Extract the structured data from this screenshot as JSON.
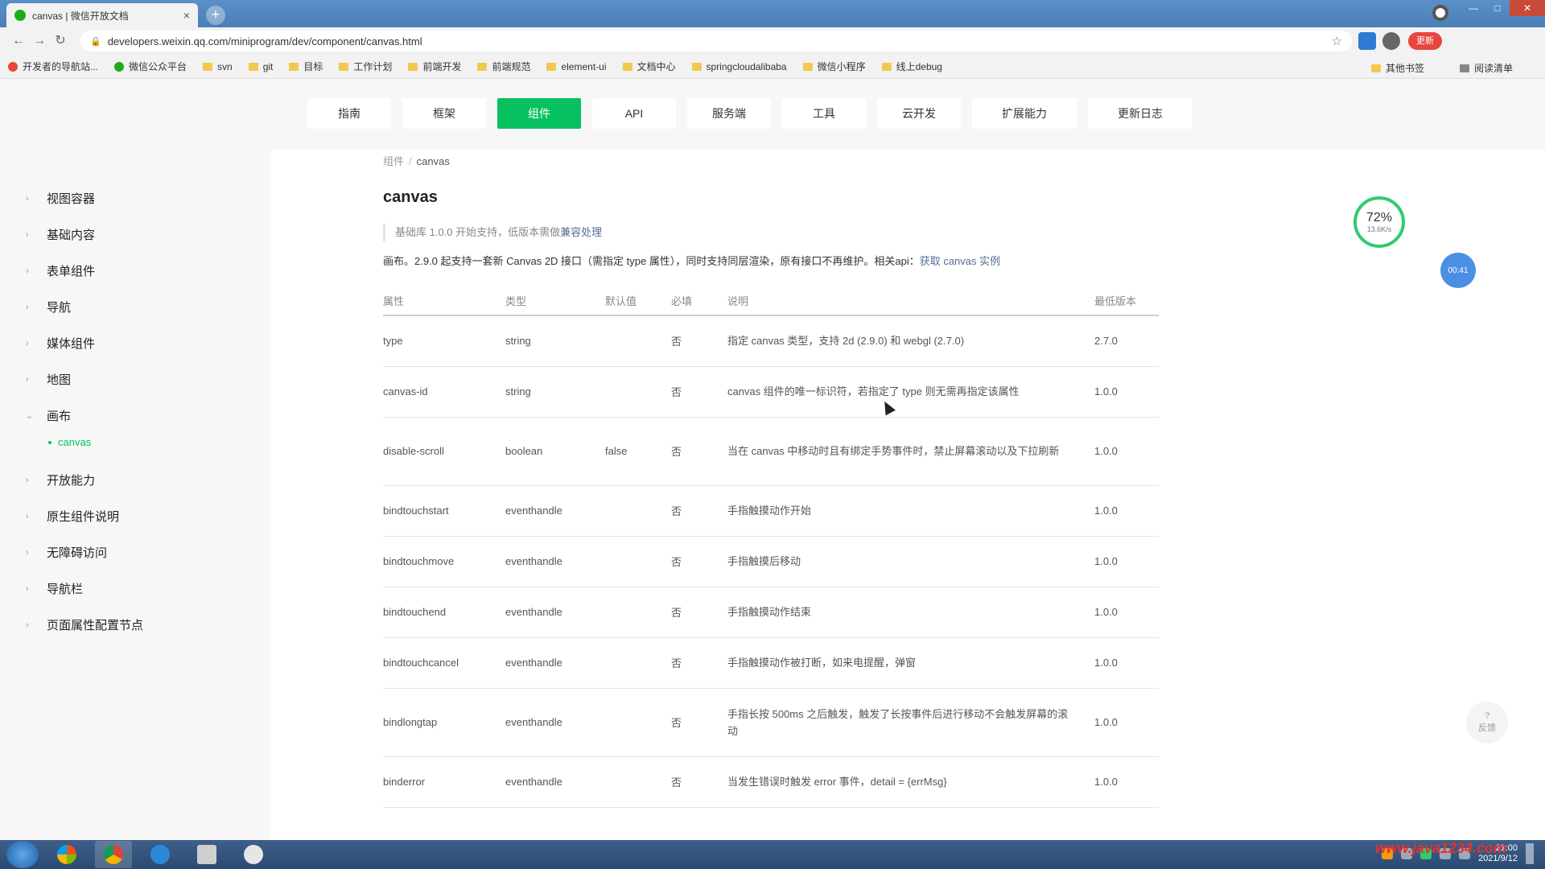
{
  "browser": {
    "tab_title": "canvas | 微信开放文档",
    "tab_close": "×",
    "new_tab": "+",
    "url": "developers.weixin.qq.com/miniprogram/dev/component/canvas.html",
    "ext_label": "更新"
  },
  "bookmarks": [
    "开发者的导航站...",
    "微信公众平台",
    "svn",
    "git",
    "目标",
    "工作计划",
    "前端开发",
    "前端规范",
    "element-ui",
    "文档中心",
    "springcloudalibaba",
    "微信小程序",
    "线上debug"
  ],
  "bookmarks_right": [
    "其他书签",
    "阅读清单"
  ],
  "topnav": [
    "指南",
    "框架",
    "组件",
    "API",
    "服务端",
    "工具",
    "云开发",
    "扩展能力",
    "更新日志"
  ],
  "topnav_active": "组件",
  "sidebar": {
    "items": [
      "视图容器",
      "基础内容",
      "表单组件",
      "导航",
      "媒体组件",
      "地图",
      "画布",
      "开放能力",
      "原生组件说明",
      "无障碍访问",
      "导航栏",
      "页面属性配置节点"
    ],
    "sub_item": "canvas"
  },
  "breadcrumb": {
    "parent": "组件",
    "sep": "/",
    "current": "canvas"
  },
  "page_title": "canvas",
  "tip": {
    "text": "基础库 1.0.0 开始支持，低版本需做",
    "link": "兼容处理"
  },
  "intro": {
    "text": "画布。2.9.0 起支持一套新 Canvas 2D 接口（需指定 type 属性），同时支持同层渲染，原有接口不再维护。相关api：",
    "link": "获取 canvas 实例"
  },
  "table": {
    "headers": [
      "属性",
      "类型",
      "默认值",
      "必填",
      "说明",
      "最低版本"
    ],
    "rows": [
      {
        "prop": "type",
        "type": "string",
        "default": "",
        "required": "否",
        "desc": "指定 canvas 类型，支持 2d (2.9.0) 和 webgl (2.7.0)",
        "version": "2.7.0"
      },
      {
        "prop": "canvas-id",
        "type": "string",
        "default": "",
        "required": "否",
        "desc": "canvas 组件的唯一标识符，若指定了 type 则无需再指定该属性",
        "version": "1.0.0"
      },
      {
        "prop": "disable-scroll",
        "type": "boolean",
        "default": "false",
        "required": "否",
        "desc": "当在 canvas 中移动时且有绑定手势事件时，禁止屏幕滚动以及下拉刷新",
        "version": "1.0.0"
      },
      {
        "prop": "bindtouchstart",
        "type": "eventhandle",
        "default": "",
        "required": "否",
        "desc": "手指触摸动作开始",
        "version": "1.0.0"
      },
      {
        "prop": "bindtouchmove",
        "type": "eventhandle",
        "default": "",
        "required": "否",
        "desc": "手指触摸后移动",
        "version": "1.0.0"
      },
      {
        "prop": "bindtouchend",
        "type": "eventhandle",
        "default": "",
        "required": "否",
        "desc": "手指触摸动作结束",
        "version": "1.0.0"
      },
      {
        "prop": "bindtouchcancel",
        "type": "eventhandle",
        "default": "",
        "required": "否",
        "desc": "手指触摸动作被打断，如来电提醒，弹窗",
        "version": "1.0.0"
      },
      {
        "prop": "bindlongtap",
        "type": "eventhandle",
        "default": "",
        "required": "否",
        "desc": "手指长按 500ms 之后触发，触发了长按事件后进行移动不会触发屏幕的滚动",
        "version": "1.0.0"
      },
      {
        "prop": "binderror",
        "type": "eventhandle",
        "default": "",
        "required": "否",
        "desc": "当发生错误时触发 error 事件，detail = {errMsg}",
        "version": "1.0.0"
      }
    ]
  },
  "widgets": {
    "progress_pct": "72%",
    "progress_unit": "13.6K/s",
    "float_label": "00:41",
    "feedback": "?",
    "feedback_label": "反馈"
  },
  "taskbar": {
    "time": "21:00",
    "date": "2021/9/12",
    "watermark": "www.java1234.com"
  }
}
